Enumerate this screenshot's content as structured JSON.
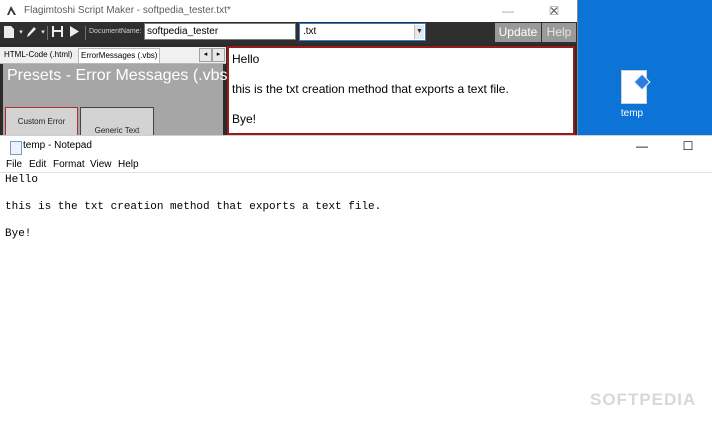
{
  "desktop": {
    "icon_label": "temp"
  },
  "script_maker": {
    "title": "Flagimtoshi Script Maker - softpedia_tester.txt*",
    "window_controls": {
      "minimize": "—",
      "maximize": "☐",
      "close": "✕"
    },
    "toolbar": {
      "document_name_label": "DocumentName:",
      "document_name_value": "softpedia_tester",
      "extension_value": ".txt",
      "update_label": "Update",
      "help_label": "Help"
    },
    "tabs": [
      {
        "label": "HTML-Code (.html)"
      },
      {
        "label": "ErrorMessages (.vbs)"
      }
    ],
    "presets": {
      "title": "Presets - Error Messages (.vbs)",
      "buttons": [
        {
          "label": "Custom Error"
        },
        {
          "label": "Generic Text"
        }
      ]
    },
    "editor_lines": [
      "Hello",
      "this is the txt creation method that exports a text file.",
      "Bye!"
    ]
  },
  "notepad": {
    "title": "temp - Notepad",
    "menu": [
      "File",
      "Edit",
      "Format",
      "View",
      "Help"
    ],
    "window_controls": {
      "minimize": "—",
      "maximize": "☐"
    },
    "lines": [
      "Hello",
      "",
      "this is the txt creation method that exports a text file.",
      "",
      "Bye!"
    ]
  },
  "watermark": "SOFTPEDIA"
}
